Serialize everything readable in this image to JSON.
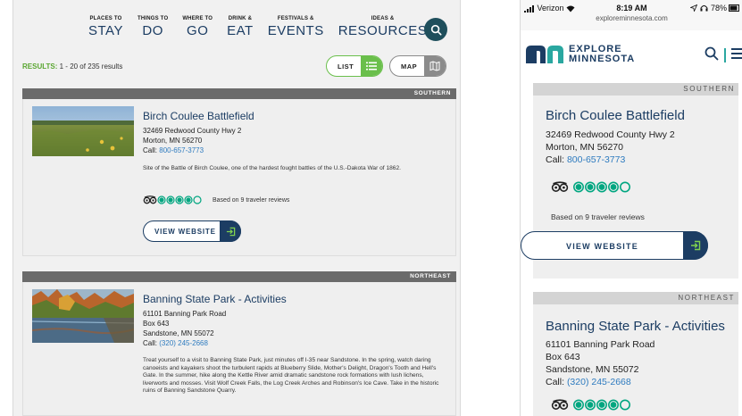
{
  "desktop": {
    "nav": [
      {
        "small": "PLACES TO",
        "big": "STAY"
      },
      {
        "small": "THINGS TO",
        "big": "DO"
      },
      {
        "small": "WHERE TO",
        "big": "GO"
      },
      {
        "small": "DRINK &",
        "big": "EAT"
      },
      {
        "small": "FESTIVALS &",
        "big": "EVENTS"
      },
      {
        "small": "IDEAS &",
        "big": "RESOURCES"
      }
    ],
    "results_label": "RESULTS:",
    "results_text": " 1 - 20 of 235 results",
    "list_label": "LIST",
    "map_label": "MAP",
    "listings": [
      {
        "region": "SOUTHERN",
        "title": "Birch Coulee Battlefield",
        "address": [
          "32469 Redwood County Hwy 2",
          "Morton, MN 56270"
        ],
        "call_label": "Call:",
        "phone": "800-657-3773",
        "description": "Site of the Battle of Birch Coulee, one of the hardest fought battles of the U.S.-Dakota War of 1862.",
        "reviews": "Based on 9 traveler reviews",
        "button": "VIEW WEBSITE"
      },
      {
        "region": "NORTHEAST",
        "title": "Banning State Park - Activities",
        "address": [
          "61101 Banning Park Road",
          "Box 643",
          "Sandstone, MN 55072"
        ],
        "call_label": "Call:",
        "phone": "(320) 245-2668",
        "description": "Treat yourself to a visit to Banning State Park, just minutes off I-35 near Sandstone. In the spring, watch daring canoeists and kayakers shoot the turbulent rapids at Blueberry Slide, Mother's Delight, Dragon's Tooth and Hell's Gate. In the summer, hike along the Kettle River amid dramatic sandstone rock formations with lush lichens, liverworts and mosses. Visit Wolf Creek Falls, the Log Creek Arches and Robinson's Ice Cave. Take in the historic ruins of Banning Sandstone Quarry."
      }
    ]
  },
  "phone": {
    "carrier": "Verizon",
    "time": "8:19 AM",
    "url": "exploreminnesota.com",
    "battery": "78%",
    "logo_line1": "EXPLORE",
    "logo_line2": "MINNESOTA",
    "listings": [
      {
        "region": "SOUTHERN",
        "title": "Birch Coulee Battlefield",
        "address": [
          "32469 Redwood County Hwy 2",
          "Morton, MN 56270"
        ],
        "call_label": "Call:",
        "phone": "800-657-3773",
        "reviews": "Based on 9 traveler reviews",
        "button": "VIEW WEBSITE"
      },
      {
        "region": "NORTHEAST",
        "title": "Banning State Park - Activities",
        "address": [
          "61101 Banning Park Road",
          "Box 643",
          "Sandstone, MN 55072"
        ],
        "call_label": "Call:",
        "phone": "(320) 245-2668"
      }
    ]
  },
  "rating": {
    "value": 4,
    "max": 5
  },
  "colors": {
    "navy": "#1c3d63",
    "green": "#6abf4b",
    "teal": "#1f4f5c",
    "region_bar": "#6b6b6b",
    "link": "#2e7bbf"
  },
  "icons": [
    "search-icon",
    "list-icon",
    "map-icon",
    "tripadvisor-icon",
    "rating-circle-icon",
    "enter-arrow-icon",
    "menu-icon",
    "explore-minnesota-logo"
  ]
}
